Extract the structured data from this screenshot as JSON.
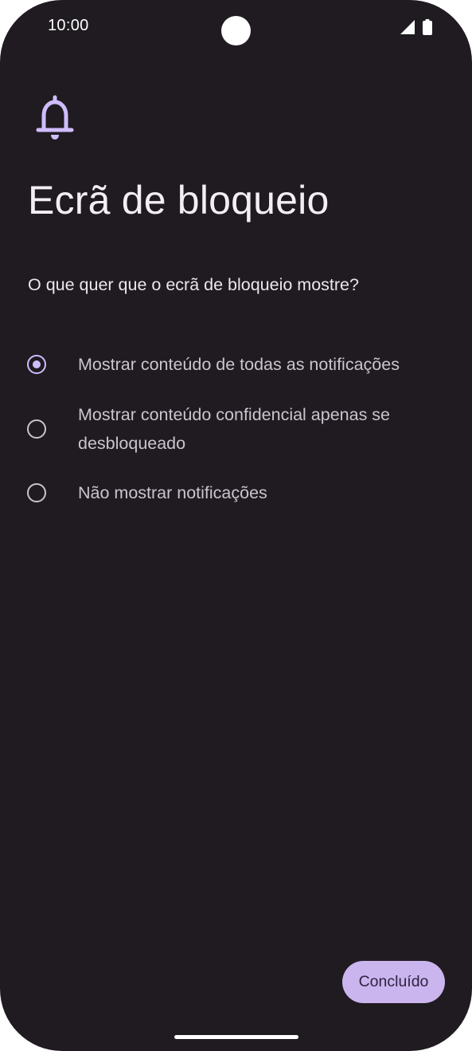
{
  "status_bar": {
    "time": "10:00",
    "icons": [
      "camera-cutout",
      "signal-icon",
      "battery-icon"
    ]
  },
  "header": {
    "icon": "bell-icon",
    "title": "Ecrã de bloqueio"
  },
  "question": "O que quer que o ecrã de bloqueio mostre?",
  "options": [
    {
      "label": "Mostrar conteúdo de todas as notificações",
      "selected": true
    },
    {
      "label": "Mostrar conteúdo confidencial apenas se desbloqueado",
      "selected": false
    },
    {
      "label": "Não mostrar notificações",
      "selected": false
    }
  ],
  "footer": {
    "done_label": "Concluído"
  },
  "colors": {
    "background": "#1f1b20",
    "accent": "#cfbcff",
    "button": "#cbb5ee"
  }
}
